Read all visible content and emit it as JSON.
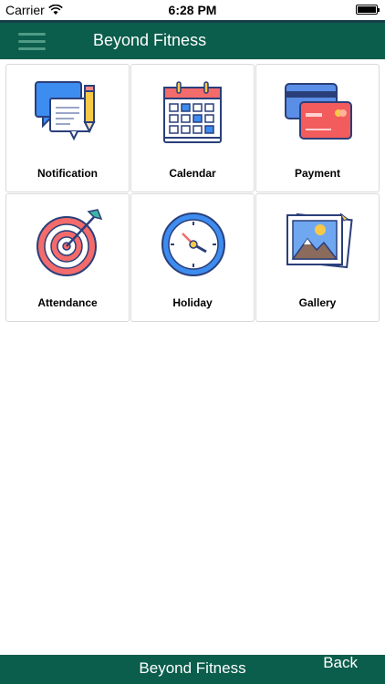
{
  "status_bar": {
    "carrier": "Carrier",
    "time": "6:28 PM"
  },
  "header": {
    "title": "Beyond Fitness"
  },
  "tiles": [
    {
      "label": "Notification",
      "icon": "notification-icon"
    },
    {
      "label": "Calendar",
      "icon": "calendar-icon"
    },
    {
      "label": "Payment",
      "icon": "payment-icon"
    },
    {
      "label": "Attendance",
      "icon": "attendance-icon"
    },
    {
      "label": "Holiday",
      "icon": "clock-icon"
    },
    {
      "label": "Gallery",
      "icon": "gallery-icon"
    }
  ],
  "footer": {
    "title": "Beyond Fitness",
    "back_label": "Back"
  },
  "colors": {
    "brand": "#0b5d4c",
    "header_border": "#153f4a"
  }
}
